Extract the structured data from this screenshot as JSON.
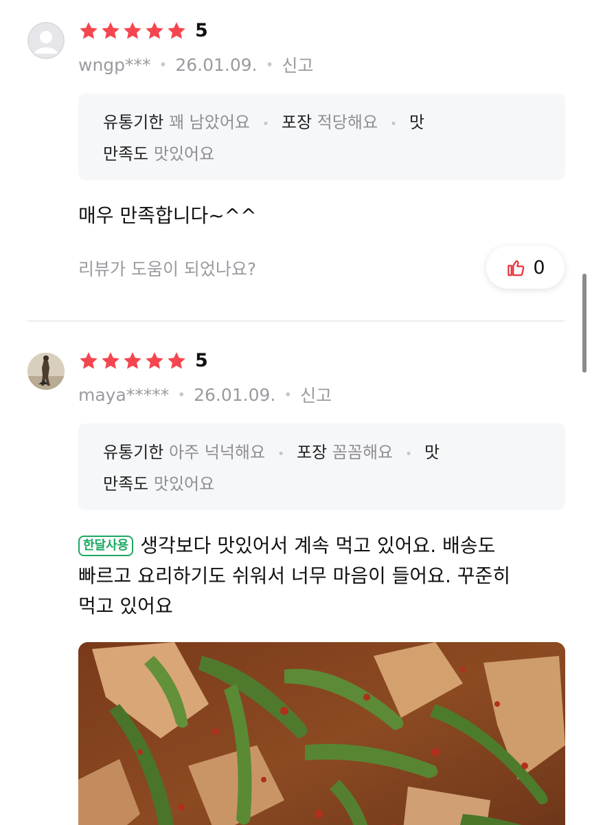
{
  "reviews": [
    {
      "avatar": "default-user-icon",
      "rating": "5",
      "user": "wngp***",
      "date": "26.01.09.",
      "report": "신고",
      "attributes": {
        "expiry_key": "유통기한",
        "expiry_val": "꽤 남았어요",
        "pack_key": "포장",
        "pack_val": "적당해요",
        "taste_key_1": "맛",
        "taste_key_2": "만족도",
        "taste_val": "맛있어요"
      },
      "body": "매우 만족합니다~^^",
      "helpful_question": "리뷰가 도움이 되었나요?",
      "like_count": "0"
    },
    {
      "avatar": "user-photo",
      "rating": "5",
      "user": "maya*****",
      "date": "26.01.09.",
      "report": "신고",
      "attributes": {
        "expiry_key": "유통기한",
        "expiry_val": "아주 넉넉해요",
        "pack_key": "포장",
        "pack_val": "꼼꼼해요",
        "taste_key_1": "맛",
        "taste_key_2": "만족도",
        "taste_val": "맛있어요"
      },
      "badge": "한달사용",
      "body_line1": "생각보다 맛있어서 계속 먹고 있어요. 배송도",
      "body_line2": "빠르고 요리하기도 쉬워서 너무 마음이 들어요. 꾸준히",
      "body_line3": "먹고 있어요"
    }
  ],
  "colors": {
    "star": "#f5464f",
    "badge": "#1aa860",
    "like_icon": "#e8313a"
  }
}
